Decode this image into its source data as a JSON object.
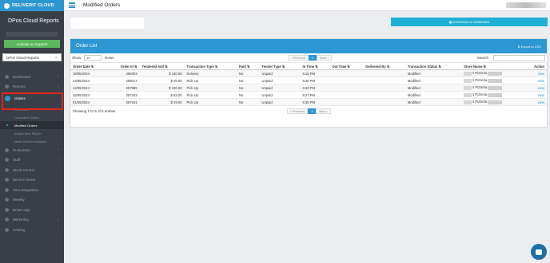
{
  "sidebar": {
    "brand": "DELIVERIT CLOUD",
    "title": "DPos Cloud Reports",
    "activate_button": "Activate as Support",
    "store_select": "DPos Cloud Reports",
    "nav": [
      {
        "label": "Dashboard",
        "icon": "dashboard-icon",
        "chevron": "›"
      },
      {
        "label": "Reports",
        "icon": "reports-icon",
        "chevron": "›"
      },
      {
        "label": "Orders",
        "icon": "orders-icon",
        "chevron": ""
      }
    ],
    "sub_items": [
      "Order List",
      "Cancelled Orders",
      "Modified Orders",
      "Invalid Item Report",
      "Make Invoice Analysis"
    ],
    "nav_bottom": [
      {
        "label": "Customers",
        "icon": "customers-icon",
        "chevron": "›"
      },
      {
        "label": "Staff",
        "icon": "staff-icon",
        "chevron": "›"
      },
      {
        "label": "Stock Control",
        "icon": "stock-icon",
        "chevron": ""
      },
      {
        "label": "Service Sheet",
        "icon": "service-icon",
        "chevron": ""
      },
      {
        "label": "Xero Integration",
        "icon": "xero-icon",
        "chevron": ""
      },
      {
        "label": "Weekly",
        "icon": "weekly-icon",
        "chevron": ""
      },
      {
        "label": "Driver App",
        "icon": "driver-icon",
        "chevron": ""
      },
      {
        "label": "Marketing",
        "icon": "marketing-icon",
        "chevron": "›"
      },
      {
        "label": "Catalog",
        "icon": "catalog-icon",
        "chevron": "›"
      }
    ]
  },
  "header": {
    "title": "Modified Orders"
  },
  "filters": {
    "date_range": "01/05/2024 to 18/05/2024"
  },
  "panel": {
    "title": "Order List",
    "export_label": "Export to CSV",
    "show_label": "Show",
    "show_value": "10",
    "rows_label": "Rows",
    "search_label": "Search",
    "previous": "Previous",
    "next": "Next",
    "current_page": "1",
    "entries_text": "Showing 1 to 5 of 5 entries"
  },
  "table": {
    "columns": [
      "Order Date",
      "Order Id",
      "Tendered Amt",
      "Transaction Type",
      "Paid",
      "Tender Type",
      "In Time",
      "Out Time",
      "Delivered By",
      "Transaction Status",
      "Store Name",
      "Action"
    ],
    "rows": [
      {
        "date": "18/05/2024",
        "id": "258303",
        "amt": "$ 130.00",
        "type": "Delivery",
        "paid": "No",
        "tender": "Unpaid",
        "in_time": "5:18 PM",
        "out_time": "",
        "delivered_by": "",
        "status": "Modified",
        "store": "s Pizzeria",
        "action": "view"
      },
      {
        "date": "14/05/2024",
        "id": "258017",
        "amt": "$ 25.00",
        "type": "Pick Up",
        "paid": "No",
        "tender": "Unpaid",
        "in_time": "5:38 PM",
        "out_time": "",
        "delivered_by": "",
        "status": "Modified",
        "store": "s Pizzeria",
        "action": "view"
      },
      {
        "date": "12/05/2024",
        "id": "257989",
        "amt": "$ 130.00",
        "type": "Pick Up",
        "paid": "No",
        "tender": "Unpaid",
        "in_time": "6:32 PM",
        "out_time": "",
        "delivered_by": "",
        "status": "Modified",
        "store": "s Pizzeria",
        "action": "view"
      },
      {
        "date": "03/05/2024",
        "id": "257343",
        "amt": "$ 63.00",
        "type": "Pick Up",
        "paid": "No",
        "tender": "Unpaid",
        "in_time": "6:27 PM",
        "out_time": "",
        "delivered_by": "",
        "status": "Modified",
        "store": "s Pizzeria",
        "action": "view"
      },
      {
        "date": "01/05/2024",
        "id": "257191",
        "amt": "$ 29.00",
        "type": "Pick Up",
        "paid": "No",
        "tender": "Unpaid",
        "in_time": "6:35 PM",
        "out_time": "",
        "delivered_by": "",
        "status": "Modified",
        "store": "s Pizzeria",
        "action": "view"
      }
    ]
  },
  "colors": {
    "accent": "#2d97d3",
    "sidebar": "#3a3f47",
    "date_button": "#1fb0d6",
    "highlight": "#e2231a",
    "activate": "#5cb85c"
  }
}
